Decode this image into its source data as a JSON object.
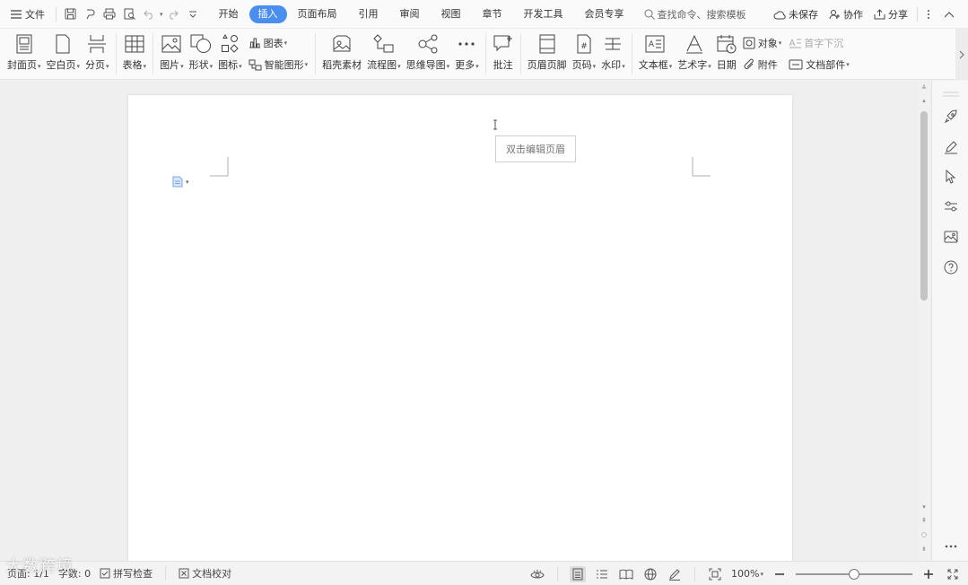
{
  "menubar": {
    "file_label": "文件",
    "tabs": [
      {
        "label": "开始"
      },
      {
        "label": "插入",
        "active": true
      },
      {
        "label": "页面布局"
      },
      {
        "label": "引用"
      },
      {
        "label": "审阅"
      },
      {
        "label": "视图"
      },
      {
        "label": "章节"
      },
      {
        "label": "开发工具"
      },
      {
        "label": "会员专享"
      }
    ],
    "search_placeholder": "查找命令、搜索模板",
    "unsaved_label": "未保存",
    "collab_label": "协作",
    "share_label": "分享",
    "accent_color": "#4a8ff0"
  },
  "ribbon": {
    "cover": "封面页",
    "blank": "空白页",
    "pagebreak": "分页",
    "table": "表格",
    "picture": "图片",
    "shape": "形状",
    "icon": "图标",
    "chart": "图表",
    "smartart": "智能图形",
    "daoke": "稻壳素材",
    "flowchart": "流程图",
    "mindmap": "思维导图",
    "more": "更多",
    "comment": "批注",
    "header_footer": "页眉页脚",
    "page_number": "页码",
    "watermark": "水印",
    "textbox": "文本框",
    "wordart": "艺术字",
    "date": "日期",
    "object": "对象",
    "attachment": "附件",
    "dropcap": "首字下沉",
    "doc_parts": "文档部件"
  },
  "document": {
    "header_tooltip": "双击编辑页眉"
  },
  "statusbar": {
    "page": "页面: 1/1",
    "words": "字数: 0",
    "spellcheck": "拼写检查",
    "proofread": "文档校对",
    "zoom": "100%",
    "zoom_fraction": 0.5
  },
  "overlay": {
    "watermark_text": "大数跨境"
  }
}
